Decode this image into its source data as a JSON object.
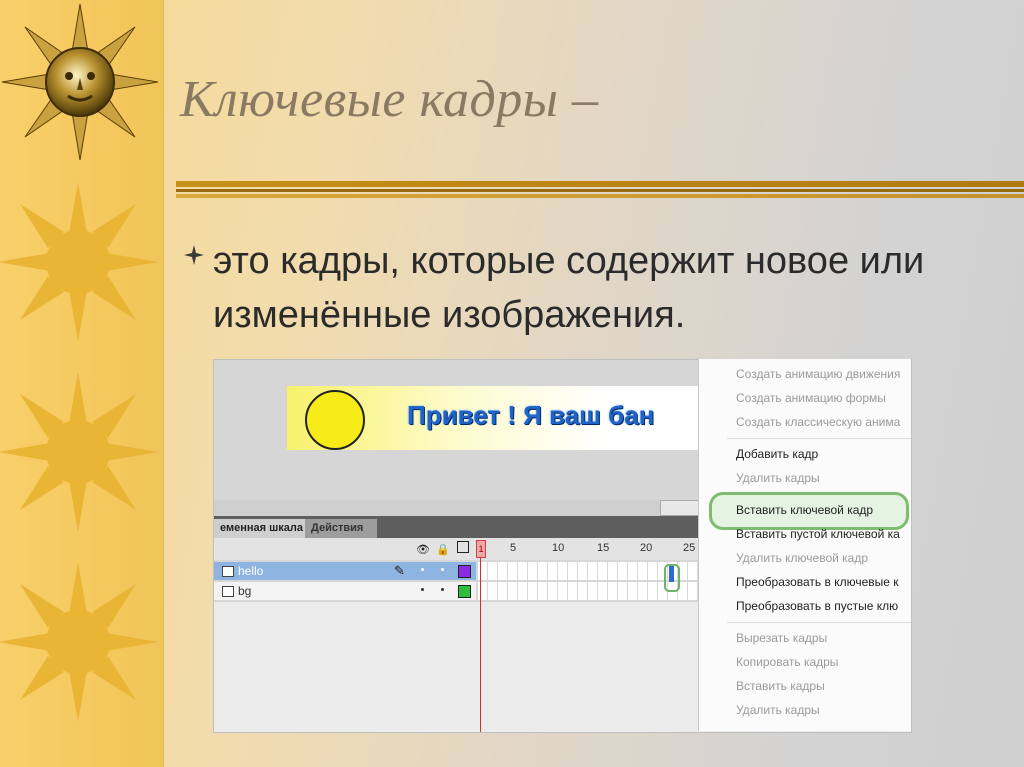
{
  "slide": {
    "title": "Ключевые кадры –",
    "bullet": "это кадры, которые содержит новое или изменённые изображения."
  },
  "screenshot": {
    "banner_text": "Привет ! Я ваш бан",
    "tabs": [
      "еменная шкала",
      "Действия"
    ],
    "frame_numbers": [
      "1",
      "5",
      "10",
      "15",
      "20",
      "25"
    ],
    "layers": [
      {
        "name": "hello",
        "color": "#8a2be2",
        "selected": true
      },
      {
        "name": "bg",
        "color": "#2ebd3c",
        "selected": false
      }
    ]
  },
  "context_menu": {
    "items": [
      {
        "label": "Создать анимацию движения",
        "enabled": false
      },
      {
        "label": "Создать анимацию формы",
        "enabled": false
      },
      {
        "label": "Создать классическую анима",
        "enabled": false
      },
      {
        "label": "Добавить кадр",
        "enabled": true
      },
      {
        "label": "Удалить кадры",
        "enabled": false
      },
      {
        "label": "Вставить ключевой кадр",
        "enabled": true,
        "highlighted": true
      },
      {
        "label": "Вставить пустой ключевой ка",
        "enabled": true
      },
      {
        "label": "Удалить ключевой кадр",
        "enabled": false
      },
      {
        "label": "Преобразовать в ключевые к",
        "enabled": true
      },
      {
        "label": "Преобразовать в пустые клю",
        "enabled": true
      },
      {
        "label": "Вырезать кадры",
        "enabled": false
      },
      {
        "label": "Копировать кадры",
        "enabled": false
      },
      {
        "label": "Вставить кадры",
        "enabled": false
      },
      {
        "label": "Удалить кадры",
        "enabled": false
      }
    ]
  },
  "colors": {
    "title": "#8b7a63",
    "rule": "#b07a0f",
    "highlight": "#7dbd6e",
    "accent_blue": "#1f64c8"
  }
}
